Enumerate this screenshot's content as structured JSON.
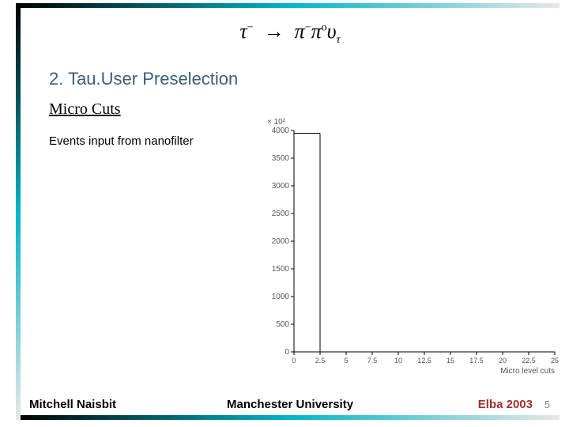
{
  "title_formula": "τ⁻ → π⁻π⁰ν_τ",
  "section": "2. Tau.User Preselection",
  "sub": "Micro Cuts",
  "events_label": "Events input from nanofilter",
  "footer": {
    "author": "Mitchell Naisbit",
    "uni": "Manchester University",
    "conf": "Elba 2003",
    "page": "5"
  },
  "chart_data": {
    "type": "bar",
    "title": "",
    "xlabel": "Micro level cuts",
    "ylabel": "",
    "y_scale_label": "× 10²",
    "xlim": [
      0,
      25
    ],
    "ylim": [
      0,
      4000
    ],
    "xticks": [
      0,
      2.5,
      5,
      7.5,
      10,
      12.5,
      15,
      17.5,
      20,
      22.5,
      25
    ],
    "yticks": [
      0,
      500,
      1000,
      1500,
      2000,
      2500,
      3000,
      3500,
      4000
    ],
    "categories": [
      1
    ],
    "values": [
      3950
    ]
  }
}
